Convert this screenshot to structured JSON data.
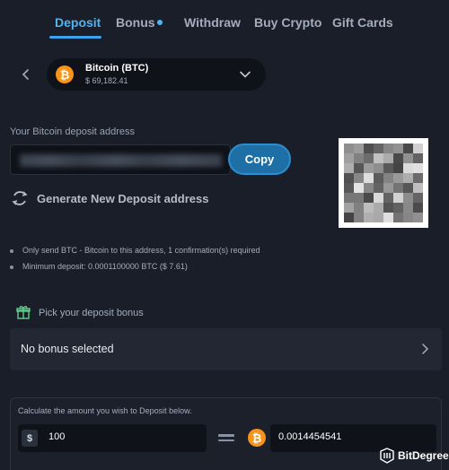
{
  "tabs": [
    {
      "label": "Deposit",
      "active": true
    },
    {
      "label": "Bonus",
      "active": false
    },
    {
      "label": "Withdraw",
      "active": false
    },
    {
      "label": "Buy Crypto",
      "active": false
    },
    {
      "label": "Gift Cards",
      "active": false
    }
  ],
  "currency": {
    "symbol_glyph": "₿",
    "name": "Bitcoin (BTC)",
    "price": "$ 69,182.41"
  },
  "deposit": {
    "address_label": "Your Bitcoin deposit address",
    "copy_label": "Copy",
    "generate_label": "Generate New Deposit address"
  },
  "notes": [
    "Only send BTC - Bitcoin to this address, 1 confirmation(s) required",
    "Minimum deposit: 0.0001100000 BTC  ($ 7.61)"
  ],
  "bonus": {
    "title": "Pick your deposit bonus",
    "selected": "No bonus selected"
  },
  "calculator": {
    "title": "Calculate the amount you wish to Deposit below.",
    "fiat_symbol": "$",
    "fiat_value": "100",
    "crypto_value": "0.0014454541"
  },
  "watermark": {
    "text": "BitDegree"
  },
  "colors": {
    "background": "#1a1e28",
    "accent": "#4fb5f0",
    "button": "#1d6fa6",
    "bitcoin": "#f7931a"
  }
}
